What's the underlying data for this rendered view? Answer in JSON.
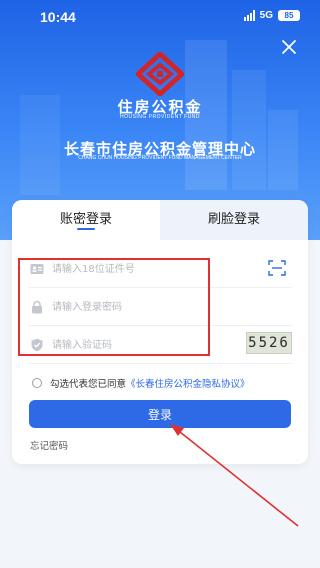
{
  "status_bar": {
    "time": "10:44",
    "network": "5G",
    "battery": "85"
  },
  "brand": {
    "name_cn": "住房公积金",
    "name_en": "HOUSING PROVIDENT FUND",
    "center_cn": "长春市住房公积金管理中心",
    "center_en": "CHANG CHUN HOUSING PROVIDENT FUND MANAGEMENT CENTER"
  },
  "tabs": [
    {
      "label": "账密登录",
      "active": true
    },
    {
      "label": "刷脸登录",
      "active": false
    }
  ],
  "form": {
    "id_placeholder": "请输入18位证件号",
    "password_placeholder": "请输入登录密码",
    "captcha_placeholder": "请输入验证码",
    "captcha_code": "5526"
  },
  "agreement": {
    "prefix": "勾选代表您已同意",
    "link": "《长春住房公积金隐私协议》"
  },
  "login_label": "登录",
  "forgot_label": "忘记密码",
  "colors": {
    "primary": "#2f6ae6",
    "header_top": "#1e63e6",
    "annotation_red": "#e03030",
    "logo_red": "#d0262a"
  }
}
